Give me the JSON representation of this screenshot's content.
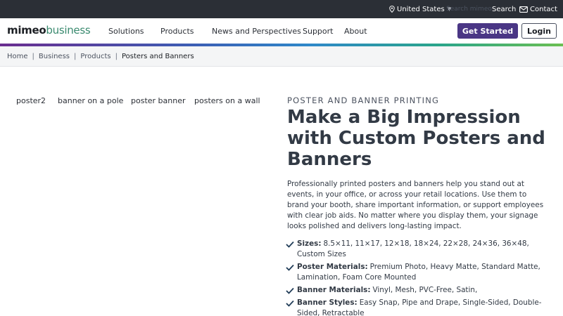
{
  "topbar": {
    "region": "United States",
    "search_placeholder": "Search mimeo",
    "search": "Search",
    "contact": "Contact"
  },
  "logo": {
    "part1": "mimeo",
    "part2": "business"
  },
  "nav": {
    "items": [
      "Solutions",
      "Products",
      "News and Perspectives",
      "Support",
      "About"
    ],
    "get_started": "Get Started",
    "login": "Login"
  },
  "breadcrumb": [
    "Home",
    "Business",
    "Products",
    "Posters and Banners"
  ],
  "thumb_tabs": [
    "poster2",
    "banner on a pole",
    "poster banner",
    "posters on a wall"
  ],
  "hero": {
    "eyebrow": "POSTER AND BANNER PRINTING",
    "headline": "Make a Big Impression with Custom Posters and Banners",
    "lead": "Professionally printed posters and banners help you stand out at events, in your office, or across your retail locations. Use them to brand your booth, share important information, or support employees with clear job aids. No matter where you display them, your signage looks polished and delivers long-lasting impact.",
    "features": [
      {
        "label": "Sizes:",
        "text": "8.5×11, 11×17, 12×18, 18×24, 22×28, 24×36, 36×48, Custom Sizes"
      },
      {
        "label": "Poster Materials:",
        "text": "Premium Photo, Heavy Matte, Standard Matte, Lamination, Foam Core Mounted"
      },
      {
        "label": "Banner Materials:",
        "text": "Vinyl, Mesh, PVC-Free, Satin,"
      },
      {
        "label": "Banner Styles:",
        "text": "Easy Snap, Pipe and Drape, Single-Sided, Double-Sided, Retractable"
      }
    ]
  },
  "colors": {
    "topbar_bg": "#2b2f36",
    "brand_purple": "#4a3685",
    "logo_green": "#3a8a6f",
    "text_dark": "#323a45"
  },
  "icons": [
    "location-pin-icon",
    "chevron-down-icon",
    "mail-icon",
    "checkmark-icon"
  ]
}
